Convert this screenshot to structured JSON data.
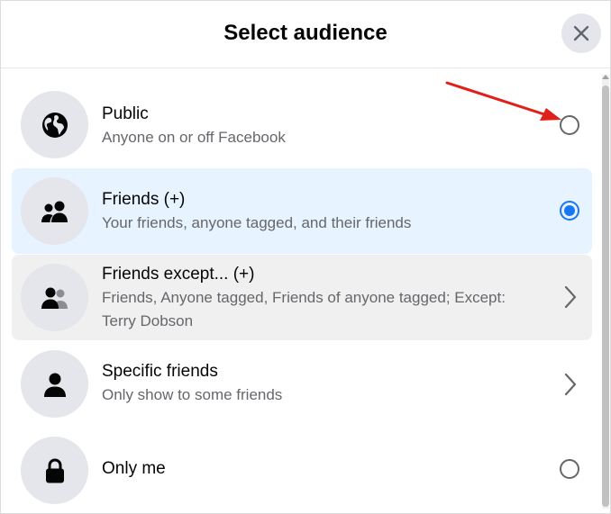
{
  "dialog": {
    "title": "Select audience",
    "close_icon": "close-icon"
  },
  "options": [
    {
      "title": "Public",
      "subtitle": "Anyone on or off Facebook",
      "icon": "globe-icon",
      "control": "radio",
      "checked": false
    },
    {
      "title": "Friends (+)",
      "subtitle": "Your friends, anyone tagged, and their friends",
      "icon": "friends-icon",
      "control": "radio",
      "checked": true
    },
    {
      "title": "Friends except... (+)",
      "subtitle_line1": "Friends, Anyone tagged, Friends of anyone tagged; Except:",
      "subtitle_line2": "Terry Dobson",
      "icon": "friends-except-icon",
      "control": "chevron"
    },
    {
      "title": "Specific friends",
      "subtitle": "Only show to some friends",
      "icon": "person-icon",
      "control": "chevron"
    },
    {
      "title": "Only me",
      "icon": "lock-icon",
      "control": "radio",
      "checked": false
    }
  ],
  "colors": {
    "accent": "#1877f2",
    "selected_bg": "#e7f3ff",
    "hover_bg": "#f0f0f0",
    "icon_bg": "#e4e6eb",
    "annotation_arrow": "#e0201b"
  }
}
